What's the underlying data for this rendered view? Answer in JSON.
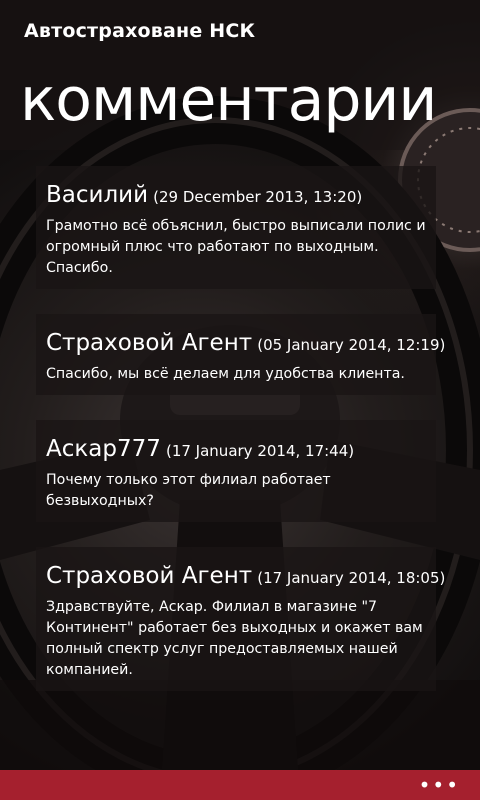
{
  "app": {
    "title": "Автостраховане НСК"
  },
  "page": {
    "title": "комментарии"
  },
  "comments": [
    {
      "author": "Василий",
      "date": "29 December 2013, 13:20",
      "text": "Грамотно всё объяснил, быстро выписали полис и огромный плюс что работают по выходным. Спасибо."
    },
    {
      "author": "Страховой Агент",
      "date": "05 January 2014, 12:19",
      "text": "Спасибо, мы всё делаем для удобства клиента."
    },
    {
      "author": "Аскар777",
      "date": "17 January 2014, 17:44",
      "text": "Почему только этот филиал работает безвыходных?"
    },
    {
      "author": "Страховой Агент",
      "date": "17 January 2014, 18:05",
      "text": "Здравствуйте, Аскар. Филиал в магазине \"7 Континент\" работает без выходных и окажет вам полный спектр услуг предоставляемых нашей компанией."
    }
  ],
  "appbar": {
    "more_icon": "ellipsis-icon",
    "more_label": "•••",
    "color": "#a5202e"
  }
}
